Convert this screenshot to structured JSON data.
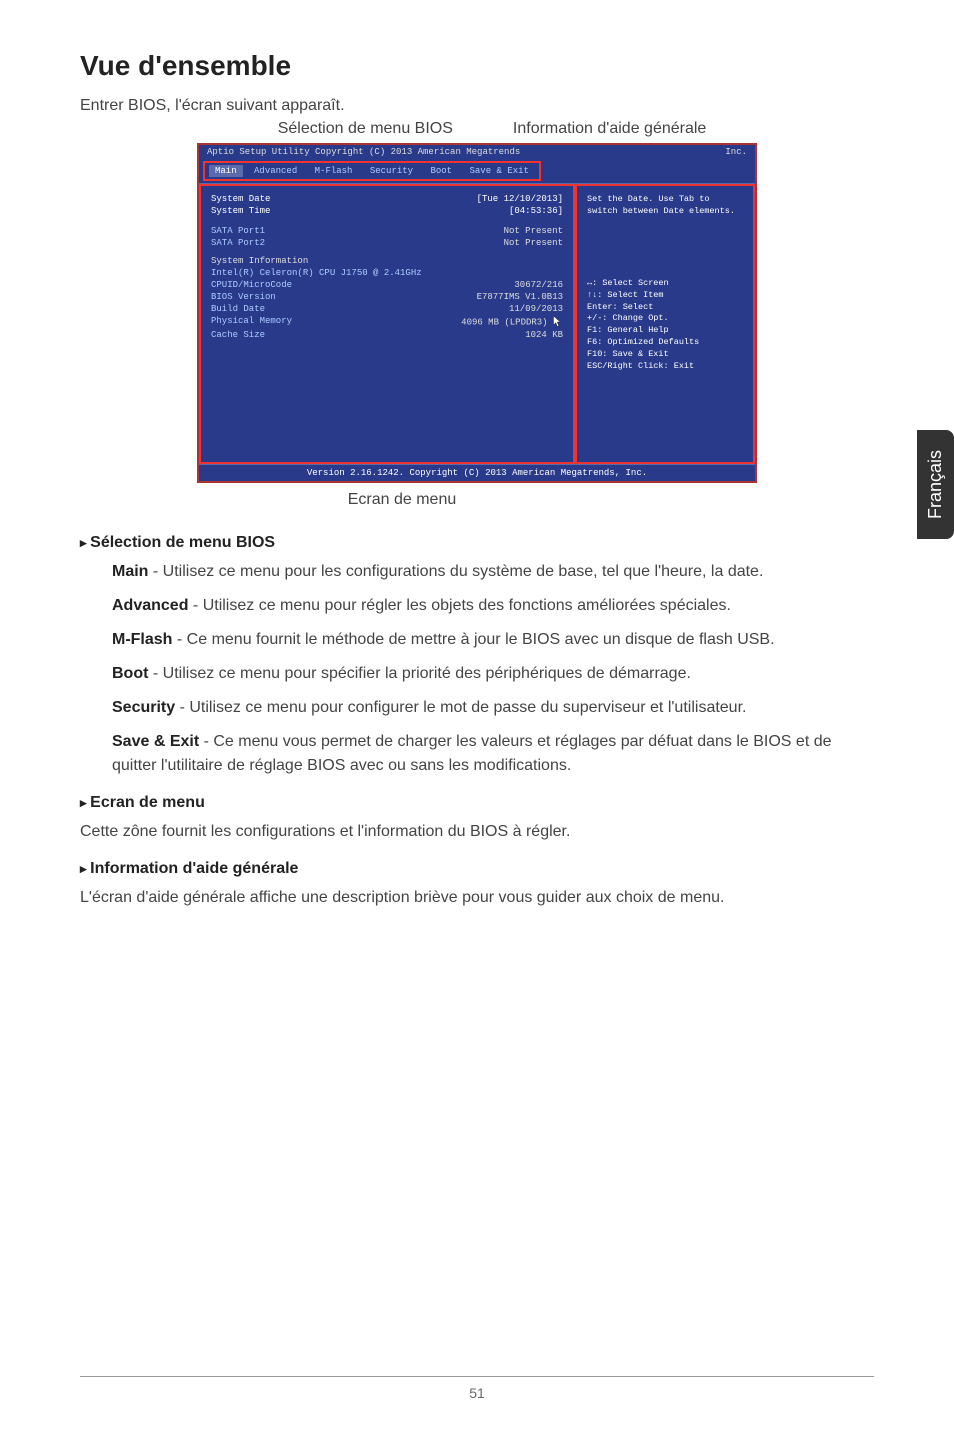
{
  "title": "Vue d'ensemble",
  "intro": "Entrer BIOS, l'écran suivant apparaît.",
  "labels": {
    "menu_selection": "Sélection de menu BIOS",
    "help_info": "Information d'aide générale"
  },
  "caption": "Ecran de menu",
  "side_tab": "Français",
  "bios": {
    "header_left": "Aptio Setup Utility  Copyright (C) 2013 American Megatrends",
    "header_right": "Inc.",
    "tabs": [
      "Main",
      "Advanced",
      "M-Flash",
      "Security",
      "Boot",
      "Save & Exit"
    ],
    "rows": [
      {
        "label": "System Date",
        "value": "[Tue 12/10/2013]",
        "highlight": true
      },
      {
        "label": "System Time",
        "value": "[04:53:36]",
        "highlight": true
      }
    ],
    "rows2": [
      {
        "label": "SATA Port1",
        "value": "Not Present"
      },
      {
        "label": "SATA Port2",
        "value": "Not Present"
      }
    ],
    "sysinfo_title": "System Information",
    "cpu_line": "Intel(R) Celeron(R) CPU J1750 @ 2.41GHz",
    "rows3": [
      {
        "label": "CPUID/MicroCode",
        "value": "30672/216"
      },
      {
        "label": "BIOS Version",
        "value": "E7877IMS V1.0B13"
      },
      {
        "label": "Build Date",
        "value": "11/09/2013"
      },
      {
        "label": "Physical Memory",
        "value": "4096 MB (LPDDR3)"
      },
      {
        "label": "Cache Size",
        "value": "1024 KB"
      }
    ],
    "help_text1": "Set the Date. Use Tab to",
    "help_text2": "switch between Date elements.",
    "help_keys": [
      "↔: Select Screen",
      "↑↓: Select Item",
      "Enter: Select",
      "+/-: Change Opt.",
      "F1: General Help",
      "F6: Optimized Defaults",
      "F10: Save & Exit",
      "ESC/Right Click: Exit"
    ],
    "footer": "Version 2.16.1242. Copyright (C) 2013 American Megatrends, Inc."
  },
  "sections": {
    "menu_selection": {
      "header": "Sélection de menu BIOS",
      "items": [
        {
          "name": "Main",
          "desc": " - Utilisez ce menu pour les configurations du système de base, tel que l'heure, la date."
        },
        {
          "name": "Advanced",
          "desc": " - Utilisez ce menu pour régler les objets des fonctions améliorées spéciales."
        },
        {
          "name": "M-Flash",
          "desc": " - Ce menu fournit le méthode de mettre à jour le BIOS avec un disque de flash USB."
        },
        {
          "name": "Boot",
          "desc": " - Utilisez ce menu pour spécifier la priorité des périphériques de démarrage."
        },
        {
          "name": "Security",
          "desc": " - Utilisez ce menu pour configurer le mot de passe du superviseur et l'utilisateur."
        },
        {
          "name": "Save & Exit",
          "desc": " - Ce menu vous permet de charger les valeurs et réglages par défuat dans le BIOS et de quitter l'utilitaire de réglage BIOS avec ou sans les modifications."
        }
      ]
    },
    "menu_screen": {
      "header": "Ecran de menu",
      "text": "Cette zône fournit les configurations et l'information du BIOS à régler."
    },
    "help_info": {
      "header": "Information d'aide générale",
      "text": "L'écran d'aide générale affiche une description briève pour vous guider aux choix de menu."
    }
  },
  "page_number": "51"
}
